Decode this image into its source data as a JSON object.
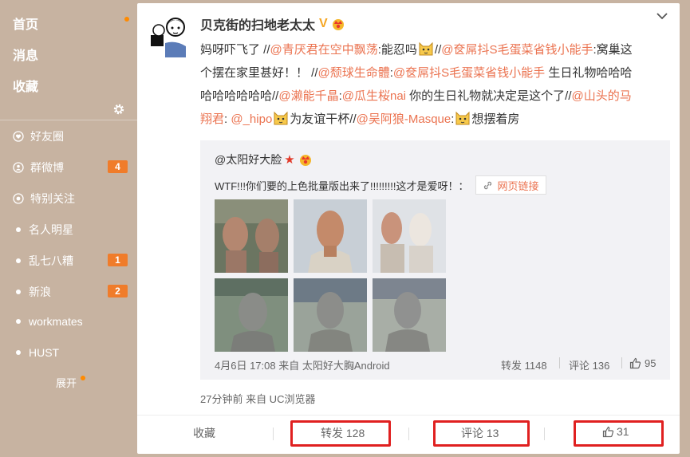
{
  "sidebar": {
    "main_nav": [
      "首页",
      "消息",
      "收藏"
    ],
    "groups": [
      {
        "label": "好友圈",
        "icon": "circle-heart-icon",
        "badge": ""
      },
      {
        "label": "群微博",
        "icon": "group-icon",
        "badge": "4"
      },
      {
        "label": "特别关注",
        "icon": "special-follow-icon",
        "badge": ""
      },
      {
        "label": "名人明星",
        "icon": "bullet",
        "badge": ""
      },
      {
        "label": "乱七八糟",
        "icon": "bullet",
        "badge": "1"
      },
      {
        "label": "新浪",
        "icon": "bullet",
        "badge": "2"
      },
      {
        "label": "workmates",
        "icon": "bullet",
        "badge": ""
      },
      {
        "label": "HUST",
        "icon": "bullet",
        "badge": ""
      }
    ],
    "expand_label": "展开"
  },
  "post": {
    "username": "贝克街的扫地老太太",
    "verified": "V",
    "text": {
      "l1_a": "妈呀吓飞了 //",
      "l1_m1": "@青厌君在空中飘荡",
      "l1_b": ":能忍吗",
      "l1_c": "//",
      "l1_m2": "@奁屌抖S毛蛋菜省钱小能手",
      "l1_d": ":窝巢这",
      "l2_a": "个摆在家里甚好！！ //",
      "l2_m1": "@颓球生命體",
      "l2_b": ":",
      "l2_m2": "@奁屌抖S毛蛋菜省钱小能手",
      "l2_c": " 生日礼物哈哈哈",
      "l3_a": "哈哈哈哈哈哈//",
      "l3_m1": "@濑能千晶",
      "l3_b": ":",
      "l3_m2": "@瓜生桜nai",
      "l3_c": " 你的生日礼物就决定是这个了//",
      "l3_m3": "@山头的马",
      "l4_m1": "翔君",
      "l4_a": ": ",
      "l4_m2": "@_hipo",
      "l4_b": "为友谊干杯//",
      "l4_m3": "@吴阿狼-Masque",
      "l4_c": ":",
      "l4_d": "想摆着房"
    },
    "quote": {
      "user": "@太阳好大脸",
      "text": "WTF!!!你们要的上色批量版出来了!!!!!!!!!这才是爱呀！：",
      "link_label": "网页链接",
      "meta": "4月6日 17:08 来自 太阳好大胸Android",
      "repost": "转发 1148",
      "comment": "评论 136",
      "like": "95"
    },
    "meta": "27分钟前 来自 UC浏览器",
    "actions": {
      "favorite": "收藏",
      "repost": "转发 128",
      "comment": "评论 13",
      "like": "31"
    }
  },
  "colors": {
    "mention": "#eb7350",
    "badge": "#f07c2a",
    "highlight_box": "#e02020",
    "sidebar_bg": "#c7b3a1"
  }
}
